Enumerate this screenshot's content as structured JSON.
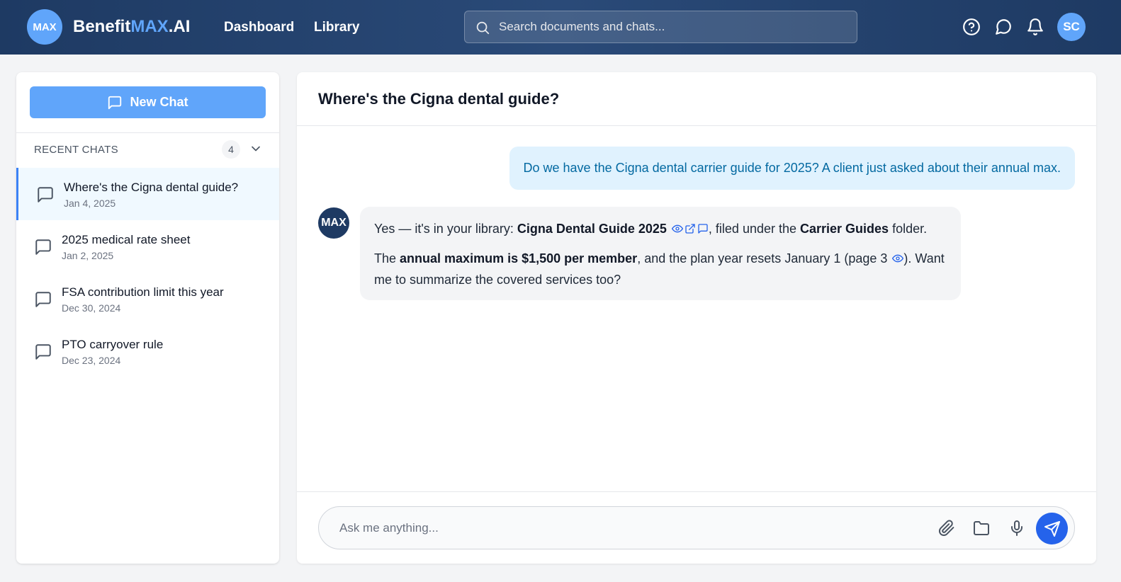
{
  "header": {
    "logo_badge": "MAX",
    "brand_prefix": "Benefit",
    "brand_highlight": "MAX",
    "brand_suffix": ".AI",
    "nav": [
      "Dashboard",
      "Library"
    ],
    "search_placeholder": "Search documents and chats...",
    "icons": [
      "help-circle-icon",
      "message-circle-icon",
      "bell-icon"
    ],
    "avatar_initials": "SC"
  },
  "sidebar": {
    "new_chat_label": "New Chat",
    "recent_label": "RECENT CHATS",
    "recent_count": "4",
    "chats": [
      {
        "title": "Where's the Cigna dental guide?",
        "date": "Jan 4, 2025",
        "active": true
      },
      {
        "title": "2025 medical rate sheet",
        "date": "Jan 2, 2025",
        "active": false
      },
      {
        "title": "FSA contribution limit this year",
        "date": "Dec 30, 2024",
        "active": false
      },
      {
        "title": "PTO carryover rule",
        "date": "Dec 23, 2024",
        "active": false
      }
    ]
  },
  "chat": {
    "title": "Where's the Cigna dental guide?",
    "user_message": "Do we have the Cigna dental carrier guide for 2025? A client just asked about their annual max.",
    "bot_avatar": "MAX",
    "bot": {
      "p1_a": "Yes — it's in your library: ",
      "p1_doc": "Cigna Dental Guide 2025",
      "p1_b": ", filed under the ",
      "p1_folder": "Carrier Guides",
      "p1_c": " folder.",
      "p2_a": "The ",
      "p2_bold": "annual maximum is $1,500 per member",
      "p2_b": ", and the plan year resets January 1 (page 3 ",
      "p2_c": "). Want me to summarize the covered services too?"
    },
    "composer_placeholder": "Ask me anything..."
  },
  "colors": {
    "header_bg": "#1e3a63",
    "accent": "#60a5fa",
    "primary_button": "#2563eb",
    "user_bubble_bg": "#e0f2fe",
    "user_bubble_text": "#0369a1",
    "bot_bubble_bg": "#f3f4f6"
  }
}
